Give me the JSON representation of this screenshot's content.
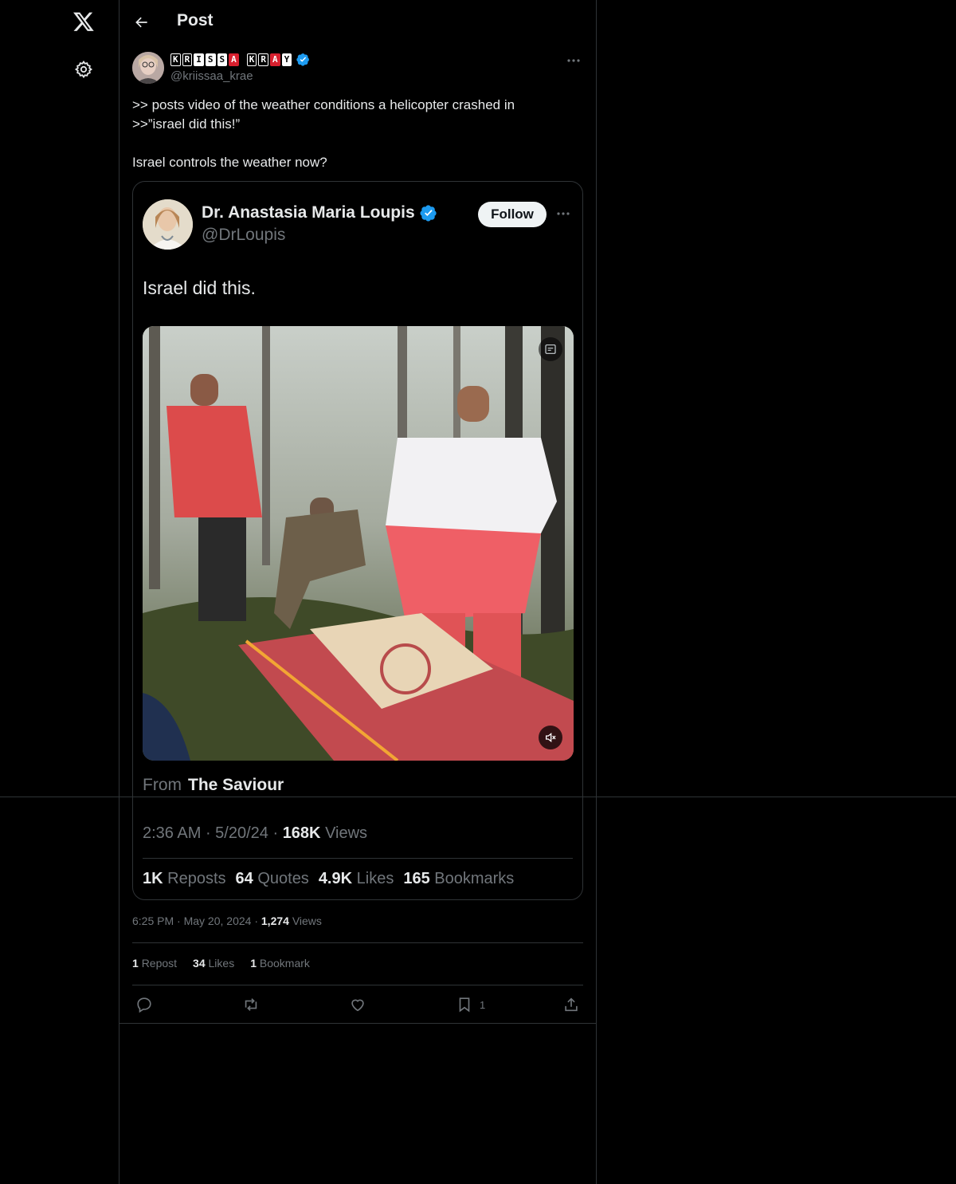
{
  "nav": {
    "logo_icon": "x-logo-icon",
    "settings_icon": "gear-icon"
  },
  "header": {
    "title": "Post",
    "back_icon": "arrow-left-icon"
  },
  "post": {
    "author_name_tiles": [
      "K",
      "R",
      "I",
      "S",
      "S",
      "A",
      " ",
      "K",
      "R",
      "A",
      "Y"
    ],
    "author_name": "KRISSA KRAY",
    "handle": "@kriissaa_krae",
    "text": ">> posts video of the weather conditions a helicopter crashed in\n>>”israel did this!”\n\nIsrael controls the weather now?",
    "time": "6:25 PM",
    "date": "May 20, 2024",
    "views_count": "1,274",
    "views_label": "Views",
    "reposts_count": "1",
    "reposts_label": "Repost",
    "likes_count": "34",
    "likes_label": "Likes",
    "bookmarks_count": "1",
    "bookmarks_label": "Bookmark",
    "bookmark_action_count": "1"
  },
  "quoted": {
    "name": "Dr. Anastasia Maria Loupis",
    "handle": "@DrLoupis",
    "follow_label": "Follow",
    "text": "Israel did this.",
    "from_label": "From",
    "from_source": "The Saviour",
    "time": "2:36 AM",
    "date": "5/20/24",
    "views_count": "168K",
    "views_label": "Views",
    "reposts_count": "1K",
    "reposts_label": "Reposts",
    "quotes_count": "64",
    "quotes_label": "Quotes",
    "likes_count": "4.9K",
    "likes_label": "Likes",
    "bookmarks_count": "165",
    "bookmarks_label": "Bookmarks"
  },
  "colors": {
    "background": "#000000",
    "text": "#e7e9ea",
    "muted": "#71767b",
    "border": "#2f3336",
    "verified": "#1d9bf0",
    "name_tile_red": "#d8202f"
  }
}
